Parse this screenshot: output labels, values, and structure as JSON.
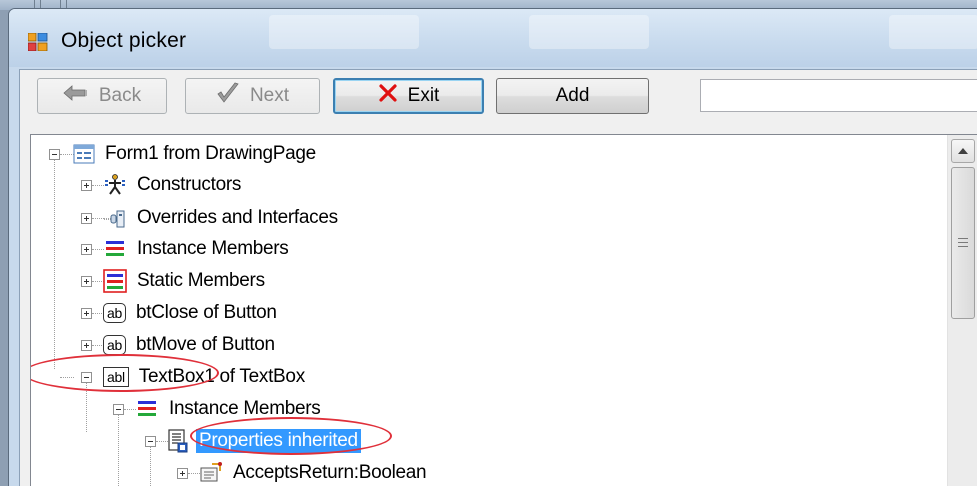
{
  "window": {
    "title": "Object picker"
  },
  "toolbar": {
    "back_label": "Back",
    "next_label": "Next",
    "exit_label": "Exit",
    "add_label": "Add",
    "search_value": ""
  },
  "tree": {
    "root_label": "Form1 from DrawingPage",
    "items": [
      {
        "label": "Constructors",
        "icon": "constructor-icon"
      },
      {
        "label": "Overrides and Interfaces",
        "icon": "overrides-icon"
      },
      {
        "label": "Instance Members",
        "icon": "instance-members-icon"
      },
      {
        "label": "Static Members",
        "icon": "static-members-icon"
      },
      {
        "label": "btClose of Button",
        "icon": "button-control-icon",
        "badge": "ab"
      },
      {
        "label": "btMove of Button",
        "icon": "button-control-icon",
        "badge": "ab"
      },
      {
        "label": "TextBox1 of TextBox",
        "icon": "textbox-control-icon",
        "badge": "abl"
      }
    ],
    "child_instance_members": "Instance Members",
    "properties_inherited": "Properties inherited",
    "accepts_return": "AcceptsReturn:Boolean"
  },
  "colors": {
    "selection": "#3399ff",
    "highlight_ellipse": "#e0303a",
    "exit_x": "#e01010"
  }
}
